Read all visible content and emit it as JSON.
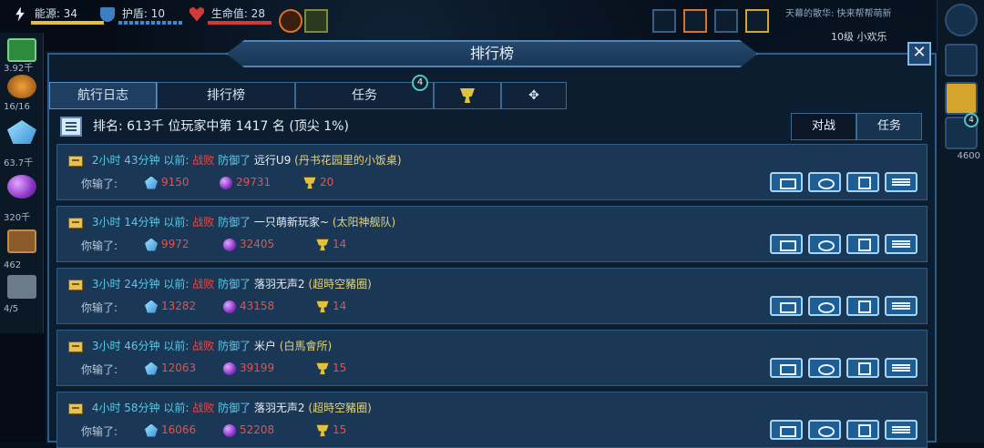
{
  "hud": {
    "energy_label": "能源: 34",
    "shield_label": "护盾: 10",
    "hp_label": "生命值: 28",
    "player_name": "天幕的散华: 快来帮帮萌新",
    "player_level": "10级 小欢乐"
  },
  "left_sidebar": {
    "items": [
      "3.92千",
      "16/16",
      "63.7千",
      "320千",
      "462",
      "4/5"
    ]
  },
  "right_sidebar": {
    "badge": "4",
    "value": "4600"
  },
  "panel": {
    "title": "排行榜",
    "close_label": "✕",
    "tabs": [
      "航行日志",
      "排行榜",
      "任务",
      "",
      ""
    ],
    "tab_badge": "4",
    "rank_text": "排名: 613千 位玩家中第 1417 名 (顶尖 1%)",
    "segments": [
      "对战",
      "任务"
    ]
  },
  "logs": [
    {
      "time": "2小时 43分钟 以前:",
      "result": "战败",
      "action": "防御了",
      "opponent": "远行U9",
      "alliance": "(丹书花园里的小饭桌)",
      "lost_label": "你输了:",
      "crystal": "9150",
      "orb": "29731",
      "trophy": "20"
    },
    {
      "time": "3小时 14分钟 以前:",
      "result": "战败",
      "action": "防御了",
      "opponent": "一只萌新玩家~",
      "alliance": "(太阳神舰队)",
      "lost_label": "你输了:",
      "crystal": "9972",
      "orb": "32405",
      "trophy": "14"
    },
    {
      "time": "3小时 24分钟 以前:",
      "result": "战败",
      "action": "防御了",
      "opponent": "落羽无声2",
      "alliance": "(超時空豬圈)",
      "lost_label": "你输了:",
      "crystal": "13282",
      "orb": "43158",
      "trophy": "14"
    },
    {
      "time": "3小时 46分钟 以前:",
      "result": "战败",
      "action": "防御了",
      "opponent": "米户",
      "alliance": "(白馬會所)",
      "lost_label": "你输了:",
      "crystal": "12063",
      "orb": "39199",
      "trophy": "15"
    },
    {
      "time": "4小时 58分钟 以前:",
      "result": "战败",
      "action": "防御了",
      "opponent": "落羽无声2",
      "alliance": "(超時空豬圈)",
      "lost_label": "你输了:",
      "crystal": "16066",
      "orb": "52208",
      "trophy": "15"
    }
  ],
  "colors": {
    "panel_bg": "#0d1d30",
    "row_bg": "#1a3756",
    "accent": "#4f86b8",
    "defeat": "#e34b4b",
    "time": "#59c9e6",
    "alliance": "#e2d47c"
  }
}
